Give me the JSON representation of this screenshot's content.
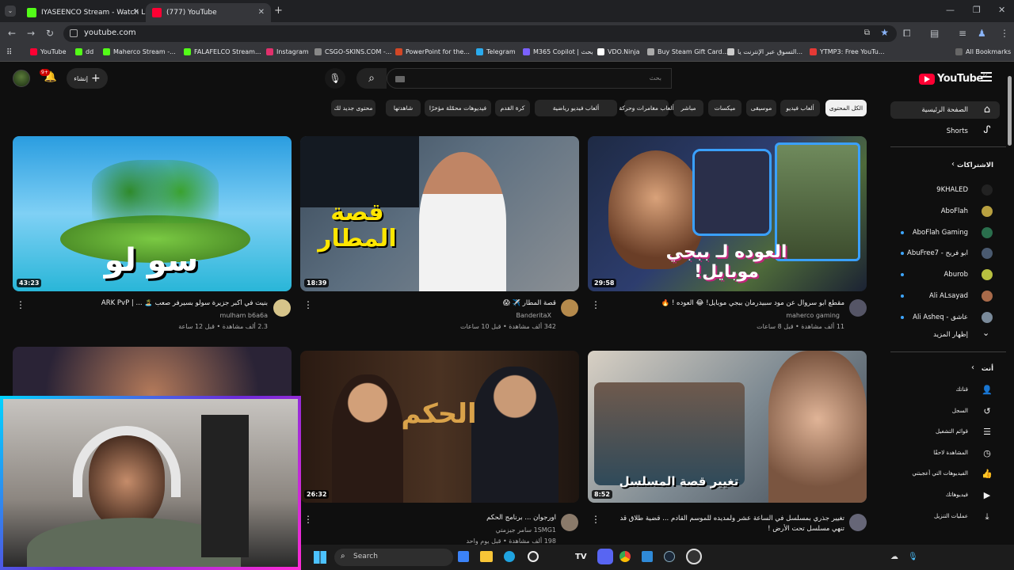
{
  "browser": {
    "tabs": [
      {
        "title": "IYASEENCO Stream - Watch Liv"
      },
      {
        "title": "(777) YouTube"
      }
    ],
    "url": "youtube.com",
    "bookmarks": [
      "YouTube",
      "dd",
      "Maherco Stream -...",
      "FALAFELCO Stream...",
      "Instagram",
      "CSGO-SKINS.COM -...",
      "PowerPoint for the...",
      "Telegram",
      "M365 Copilot | بحث",
      "VDO.Ninja",
      "Buy Steam Gift Card...",
      "التسوق عبر الإنترنت يا...",
      "YTMP3: Free YouTu..."
    ],
    "all_bookmarks": "All Bookmarks"
  },
  "youtube": {
    "logo_text": "YouTube",
    "logo_sup": "IQ",
    "search_placeholder": "بحث",
    "create_label": "إنشاء",
    "notif_count": "9+",
    "chips": [
      "الكل المحتوى",
      "ألعاب فيديو",
      "موسيقى",
      "ميكسات",
      "مباشر",
      "ألعاب مغامرات وحركة",
      "ألعاب فيديو رياضية",
      "كرة القدم",
      "فيديوهات محمّلة مؤخرًا",
      "شاهدتها",
      "محتوى جديد لك"
    ],
    "sidebar": {
      "home": "الصفحة الرئيسية",
      "shorts": "Shorts",
      "subs_header": "الاشتراكات",
      "subs": [
        "9KHALED",
        "AboFlah",
        "AboFlah Gaming",
        "ابو فريح - AbuFree7",
        "Aburob",
        "Ali ALsayad",
        "عاشق - Ali Asheq"
      ],
      "show_more": "إظهار المزيد",
      "you_header": "أنت",
      "you_items": [
        "قناتك",
        "السجل",
        "قوائم التشغيل",
        "المشاهدة لاحقًا",
        "الفيديوهات التي أعجبتني",
        "فيديوهاتك",
        "عمليات التنزيل"
      ]
    },
    "videos": [
      {
        "title": "مقطع ابو سروال عن مود سبيدرمان ببجي موبايل! 😂 العوده ! 🔥",
        "channel": "maherco gaming",
        "meta": "11 ألف مشاهدة • قبل 8 ساعات",
        "duration": "29:58",
        "thumb_text": "العوده لـ ببجي موبايل!"
      },
      {
        "title": "قصة المطار ✈️ 😱",
        "channel": "BanderitaX",
        "meta": "342 ألف مشاهدة • قبل 10 ساعات",
        "duration": "18:39",
        "thumb_text": "قصة المطار"
      },
      {
        "title": "بنيت في أكبر جزيرة سولو بسيرفر صعب 🏝️ ... | ARK PvP",
        "channel": "mulham b6a6a",
        "meta": "2.3 ألف مشاهدة • قبل 12 ساعة",
        "duration": "43:23",
        "thumb_text": "سو لو"
      },
      {
        "title": "تغيير جذري بمسلسل في الساعة عشر ولمديده للموسم القادم ... قضية طلاق قد تنهي مسلسل تحت الأرض !",
        "channel": "",
        "meta": "",
        "duration": "8:52",
        "thumb_text": "تغيير قصة المسلسل"
      },
      {
        "title": "اورجوان ... برنامج الحكم",
        "channel": "1SMG1 سامر جيزمتي",
        "meta": "198 ألف مشاهدة • قبل يوم واحد",
        "duration": "26:32",
        "thumb_text": "الحكم"
      }
    ]
  },
  "taskbar": {
    "search": "Search"
  }
}
